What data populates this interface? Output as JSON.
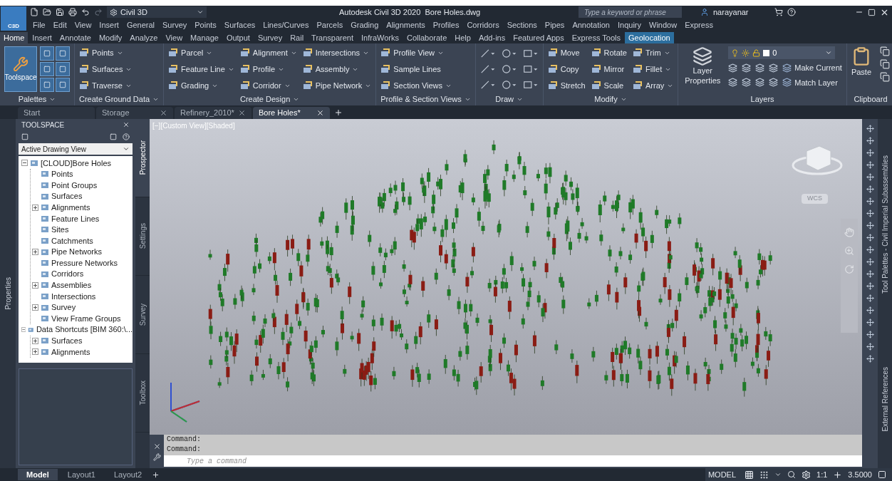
{
  "title_bar": {
    "app_button": "C3D",
    "workspace": "Civil 3D",
    "title": "Autodesk Civil 3D 2020  Bore Holes.dwg",
    "search_placeholder": "Type a keyword or phrase",
    "user": "narayanar"
  },
  "menu_bar": [
    "File",
    "Edit",
    "View",
    "Insert",
    "General",
    "Survey",
    "Points",
    "Surfaces",
    "Lines/Curves",
    "Parcels",
    "Grading",
    "Alignments",
    "Profiles",
    "Corridors",
    "Sections",
    "Pipes",
    "Annotation",
    "Inquiry",
    "Window",
    "Express"
  ],
  "ribbon_tabs": [
    {
      "label": "Home",
      "selected": true
    },
    {
      "label": "Insert",
      "selected": false
    },
    {
      "label": "Annotate",
      "selected": false
    },
    {
      "label": "Modify",
      "selected": false
    },
    {
      "label": "Analyze",
      "selected": false
    },
    {
      "label": "View",
      "selected": false
    },
    {
      "label": "Manage",
      "selected": false
    },
    {
      "label": "Output",
      "selected": false
    },
    {
      "label": "Survey",
      "selected": false
    },
    {
      "label": "Rail",
      "selected": false
    },
    {
      "label": "Transparent",
      "selected": false
    },
    {
      "label": "InfraWorks",
      "selected": false
    },
    {
      "label": "Collaborate",
      "selected": false
    },
    {
      "label": "Help",
      "selected": false
    },
    {
      "label": "Add-ins",
      "selected": false
    },
    {
      "label": "Featured Apps",
      "selected": false
    },
    {
      "label": "Express Tools",
      "selected": false
    },
    {
      "label": "Geolocation",
      "selected": false,
      "highlighted": true
    }
  ],
  "ribbon_panels": [
    {
      "kind": "palettes",
      "title": "Palettes",
      "big_button": "Toolspace"
    },
    {
      "kind": "list",
      "title": "Create Ground Data",
      "columns": [
        [
          {
            "label": "Points",
            "dropdown": true
          },
          {
            "label": "Surfaces",
            "dropdown": true
          },
          {
            "label": "Traverse",
            "dropdown": true
          }
        ]
      ]
    },
    {
      "kind": "list",
      "title": "Create Design",
      "columns": [
        [
          {
            "label": "Parcel",
            "dropdown": true
          },
          {
            "label": "Feature Line",
            "dropdown": true
          },
          {
            "label": "Grading",
            "dropdown": true
          }
        ],
        [
          {
            "label": "Alignment",
            "dropdown": true
          },
          {
            "label": "Profile",
            "dropdown": true
          },
          {
            "label": "Corridor",
            "dropdown": true
          }
        ],
        [
          {
            "label": "Intersections",
            "dropdown": true
          },
          {
            "label": "Assembly",
            "dropdown": true
          },
          {
            "label": "Pipe Network",
            "dropdown": true
          }
        ]
      ]
    },
    {
      "kind": "list",
      "title": "Profile & Section Views",
      "columns": [
        [
          {
            "label": "Profile View",
            "dropdown": true
          },
          {
            "label": "Sample Lines",
            "dropdown": false
          },
          {
            "label": "Section Views",
            "dropdown": true
          }
        ]
      ]
    },
    {
      "kind": "draw",
      "title": "Draw"
    },
    {
      "kind": "list",
      "title": "Modify",
      "columns": [
        [
          {
            "label": "Move",
            "dropdown": false
          },
          {
            "label": "Copy",
            "dropdown": false
          },
          {
            "label": "Stretch",
            "dropdown": false
          }
        ],
        [
          {
            "label": "Rotate",
            "dropdown": false
          },
          {
            "label": "Mirror",
            "dropdown": false
          },
          {
            "label": "Scale",
            "dropdown": false
          }
        ],
        [
          {
            "label": "Trim",
            "dropdown": true
          },
          {
            "label": "Fillet",
            "dropdown": true
          },
          {
            "label": "Array",
            "dropdown": true
          }
        ]
      ]
    },
    {
      "kind": "layers",
      "title": "Layers",
      "layer": "0",
      "big_button": "Layer Properties",
      "buttons": [
        "Make Current",
        "Match Layer"
      ]
    },
    {
      "kind": "clipboard",
      "title": "Clipboard",
      "big_button": "Paste"
    }
  ],
  "doc_tabs": [
    {
      "label": "Start",
      "selected": false,
      "closable": false
    },
    {
      "label": "Storage",
      "selected": false,
      "closable": true
    },
    {
      "label": "Refinery_2010*",
      "selected": false,
      "closable": true
    },
    {
      "label": "Bore Holes*",
      "selected": true,
      "closable": true
    }
  ],
  "toolspace": {
    "title": "TOOLSPACE",
    "view_select": "Active Drawing View",
    "side_tab": "Properties",
    "tree": [
      {
        "label": "[CLOUD]Bore Holes",
        "expanded": true,
        "children": [
          {
            "label": "Points"
          },
          {
            "label": "Point Groups"
          },
          {
            "label": "Surfaces"
          },
          {
            "label": "Alignments",
            "expanded": false
          },
          {
            "label": "Feature Lines"
          },
          {
            "label": "Sites"
          },
          {
            "label": "Catchments"
          },
          {
            "label": "Pipe Networks",
            "expanded": false
          },
          {
            "label": "Pressure Networks"
          },
          {
            "label": "Corridors"
          },
          {
            "label": "Assemblies",
            "expanded": false
          },
          {
            "label": "Intersections"
          },
          {
            "label": "Survey",
            "expanded": false
          },
          {
            "label": "View Frame Groups"
          }
        ]
      },
      {
        "label": "Data Shortcuts [BIM 360:\\...",
        "expanded": true,
        "children": [
          {
            "label": "Surfaces",
            "expanded": false
          },
          {
            "label": "Alignments",
            "expanded": false
          }
        ]
      }
    ],
    "tabs": [
      {
        "label": "Prospector",
        "selected": true
      },
      {
        "label": "Settings",
        "selected": false
      },
      {
        "label": "Survey",
        "selected": false
      },
      {
        "label": "Toolbox",
        "selected": false
      }
    ]
  },
  "viewport": {
    "view_label": "[−][Custom View][Shaded]",
    "coordinate_system": "WCS",
    "right_tabs": [
      "Tool Palettes - Civil Imperial Subassemblies",
      "External References"
    ]
  },
  "command_line": {
    "history": [
      "Command:",
      "Command:"
    ],
    "placeholder": "Type a command"
  },
  "layout_tabs": [
    {
      "label": "Model",
      "selected": true
    },
    {
      "label": "Layout1",
      "selected": false
    },
    {
      "label": "Layout2",
      "selected": false
    }
  ],
  "status_bar": {
    "space": "MODEL",
    "scale": "1:1",
    "value": "3.5000"
  }
}
